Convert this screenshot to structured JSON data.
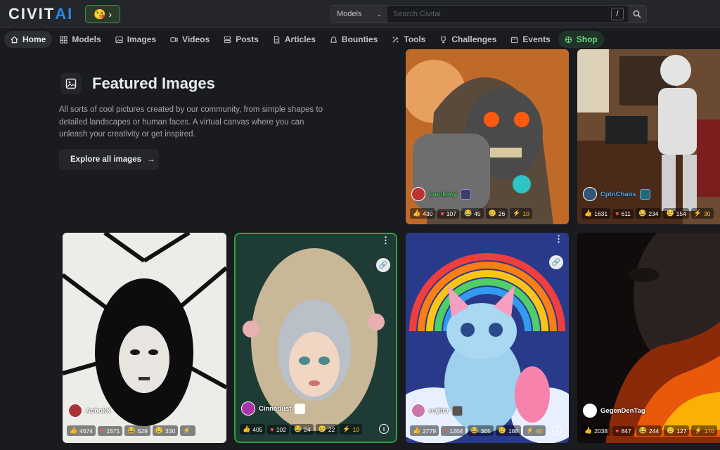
{
  "header": {
    "logo_left": "CIVIT",
    "logo_right": "AI",
    "emoji": "😘",
    "search_select": "Models",
    "search_placeholder": "Search Civitai",
    "search_shortcut": "/"
  },
  "nav": [
    {
      "label": "Home",
      "icon": "home-icon"
    },
    {
      "label": "Models",
      "icon": "models-icon"
    },
    {
      "label": "Images",
      "icon": "image-icon"
    },
    {
      "label": "Videos",
      "icon": "video-icon"
    },
    {
      "label": "Posts",
      "icon": "posts-icon"
    },
    {
      "label": "Articles",
      "icon": "article-icon"
    },
    {
      "label": "Bounties",
      "icon": "bounty-icon"
    },
    {
      "label": "Tools",
      "icon": "tools-icon"
    },
    {
      "label": "Challenges",
      "icon": "trophy-icon"
    },
    {
      "label": "Events",
      "icon": "calendar-icon"
    },
    {
      "label": "Shop",
      "icon": "shop-icon"
    }
  ],
  "featured": {
    "title": "Featured Images",
    "description": "All sorts of cool pictures created by our community, from simple shapes to detailed landscapes or human faces. A virtual canvas where you can unleash your creativity or get inspired.",
    "explore_label": "Explore all images"
  },
  "cards": [
    {
      "user": "LamEmy",
      "like": "430",
      "heart": "107",
      "laugh": "45",
      "cry": "26",
      "buzz": "10"
    },
    {
      "user": "CptnChaos",
      "like": "1631",
      "heart": "611",
      "laugh": "234",
      "cry": "154",
      "buzz": "30"
    },
    {
      "user": "AshokX",
      "like": "4674",
      "heart": "1571",
      "laugh": "529",
      "cry": "330",
      "buzz": ""
    },
    {
      "user": "Cinnadust",
      "like": "405",
      "heart": "102",
      "laugh": "24",
      "cry": "22",
      "buzz": "10"
    },
    {
      "user": "reijiita",
      "like": "2779",
      "heart": "1204",
      "laugh": "365",
      "cry": "188",
      "buzz": "90"
    },
    {
      "user": "GegenDenTag",
      "like": "2038",
      "heart": "847",
      "laugh": "244",
      "cry": "127",
      "buzz": "170"
    }
  ],
  "colors": {
    "accent": "#228be6",
    "shop": "#69db7c",
    "selected": "#2f9e44",
    "buzz": "#fcc419"
  }
}
